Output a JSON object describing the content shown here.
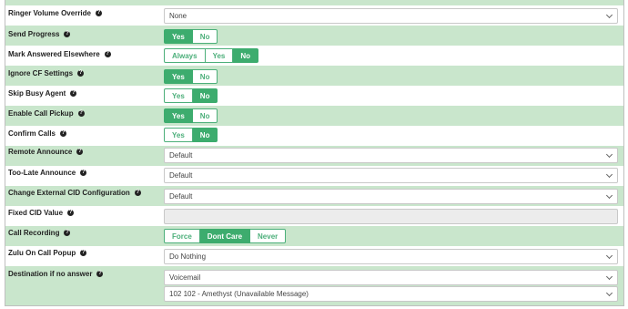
{
  "rows": {
    "ringer": {
      "label": "Ringer Volume Override",
      "value": "None"
    },
    "send_progress": {
      "label": "Send Progress",
      "options": [
        "Yes",
        "No"
      ],
      "selected": "Yes"
    },
    "mark_answered": {
      "label": "Mark Answered Elsewhere",
      "options": [
        "Always",
        "Yes",
        "No"
      ],
      "selected": "No"
    },
    "ignore_cf": {
      "label": "Ignore CF Settings",
      "options": [
        "Yes",
        "No"
      ],
      "selected": "Yes"
    },
    "skip_busy": {
      "label": "Skip Busy Agent",
      "options": [
        "Yes",
        "No"
      ],
      "selected": "No"
    },
    "call_pickup": {
      "label": "Enable Call Pickup",
      "options": [
        "Yes",
        "No"
      ],
      "selected": "Yes"
    },
    "confirm_calls": {
      "label": "Confirm Calls",
      "options": [
        "Yes",
        "No"
      ],
      "selected": "No"
    },
    "remote_announce": {
      "label": "Remote Announce",
      "value": "Default"
    },
    "too_late": {
      "label": "Too-Late Announce",
      "value": "Default"
    },
    "ext_cid": {
      "label": "Change External CID Configuration",
      "value": "Default"
    },
    "fixed_cid": {
      "label": "Fixed CID Value",
      "value": ""
    },
    "recording": {
      "label": "Call Recording",
      "options": [
        "Force",
        "Dont Care",
        "Never"
      ],
      "selected": "Dont Care"
    },
    "zulu": {
      "label": "Zulu On Call Popup",
      "value": "Do Nothing"
    },
    "destination": {
      "label": "Destination if no answer",
      "value": "Voicemail",
      "value2": "102 102 - Amethyst (Unavailable Message)"
    }
  },
  "help_glyph": "?",
  "colors": {
    "accent": "#3dac6e",
    "row_green": "#c9e6cc"
  }
}
